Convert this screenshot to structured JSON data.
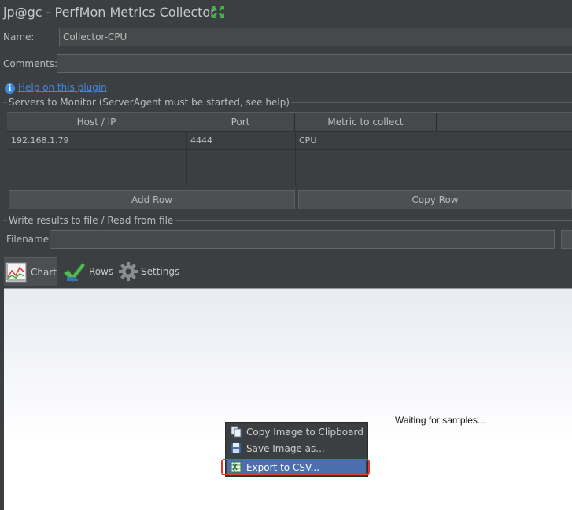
{
  "window": {
    "title": "jp@gc - PerfMon Metrics Collector"
  },
  "form": {
    "name_label": "Name:",
    "name_value": "Collector-CPU",
    "comments_label": "Comments:",
    "comments_value": ""
  },
  "help": {
    "icon": "info-icon",
    "link_text": "Help on this plugin"
  },
  "servers": {
    "group_title": "Servers to Monitor (ServerAgent must be started, see help)",
    "columns": [
      "Host / IP",
      "Port",
      "Metric to collect",
      ""
    ],
    "rows": [
      {
        "host": "192.168.1.79",
        "port": "4444",
        "metric": "CPU",
        "params": ""
      }
    ],
    "add_row_label": "Add Row",
    "copy_row_label": "Copy Row"
  },
  "file": {
    "group_title": "Write results to file / Read from file",
    "filename_label": "Filename",
    "filename_value": ""
  },
  "tabs": [
    {
      "label": "Chart",
      "icon": "line-chart-icon",
      "active": true
    },
    {
      "label": "Rows",
      "icon": "checkmark-icon",
      "active": false
    },
    {
      "label": "Settings",
      "icon": "gear-icon",
      "active": false
    }
  ],
  "chart": {
    "status_text": "Waiting for samples..."
  },
  "context_menu": {
    "items": [
      {
        "label": "Copy Image to Clipboard",
        "icon": "copy-icon"
      },
      {
        "label": "Save Image as...",
        "icon": "floppy-disk-icon"
      },
      {
        "label": "Export to CSV...",
        "icon": "spreadsheet-icon",
        "selected": true
      }
    ]
  },
  "colors": {
    "background": "#3c3f41",
    "link": "#3d8be0",
    "menu_selection": "#4b6eaf",
    "highlight_outline": "#e03a2f"
  }
}
